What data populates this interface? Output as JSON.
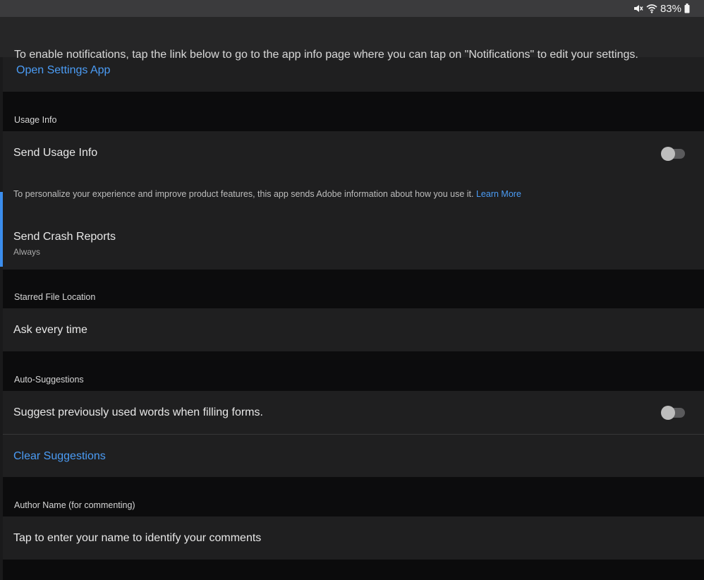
{
  "status_bar": {
    "icons": [
      "mute-icon",
      "wifi-icon",
      "battery-icon"
    ],
    "battery_text": "83%"
  },
  "notifications": {
    "description": "To enable notifications, tap the link below to go to the app info page where you can tap on \"Notifications\" to edit your settings.",
    "link_label": "Open Settings App"
  },
  "usage_info": {
    "header": "Usage Info",
    "send_usage_label": "Send Usage Info",
    "send_usage_enabled": false,
    "description": "To personalize your experience and improve product features, this app sends Adobe information about how you use it.",
    "learn_more": "Learn More",
    "crash_reports_label": "Send Crash Reports",
    "crash_reports_value": "Always"
  },
  "starred_location": {
    "header": "Starred File Location",
    "value": "Ask every time"
  },
  "auto_suggestions": {
    "header": "Auto-Suggestions",
    "suggest_label": "Suggest previously used words when filling forms.",
    "suggest_enabled": false,
    "clear_label": "Clear Suggestions"
  },
  "author_name": {
    "header": "Author Name (for commenting)",
    "placeholder": "Tap to enter your name to identify your comments"
  },
  "colors": {
    "accent": "#3b8ded",
    "link": "#4b9cf5",
    "row_background": "#1f1f20",
    "section_background": "#0c0c0d"
  }
}
